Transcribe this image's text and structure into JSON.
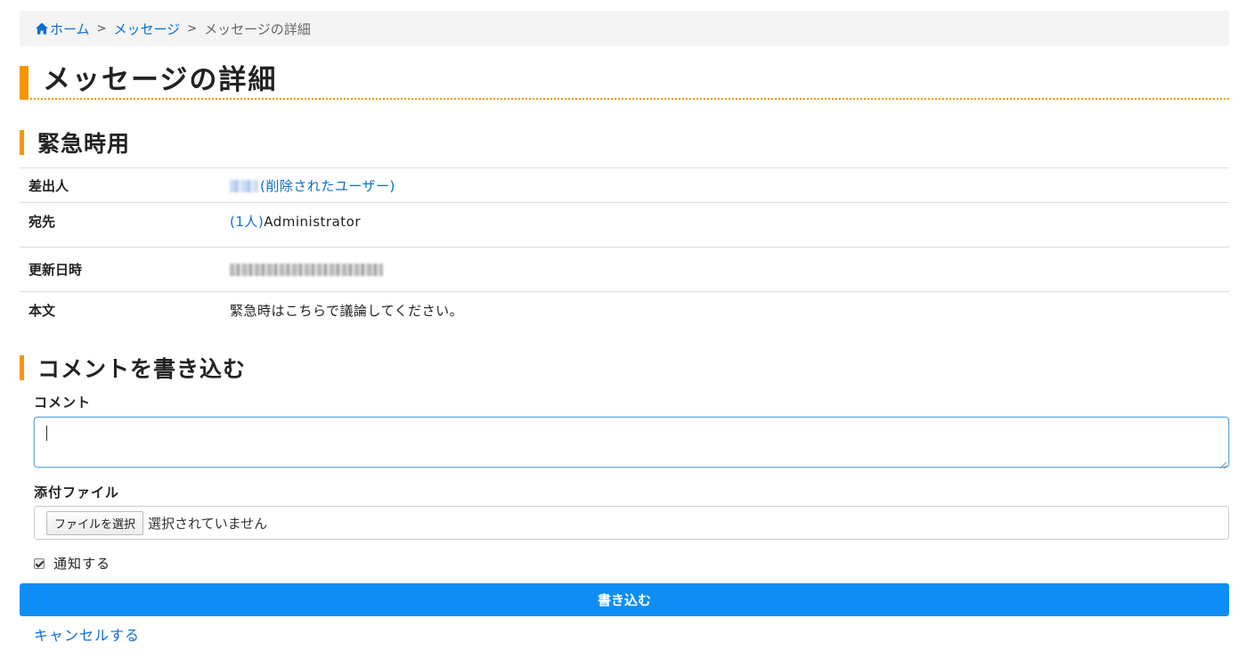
{
  "breadcrumb": {
    "home": "ホーム",
    "separator": ">",
    "messages": "メッセージ",
    "current": "メッセージの詳細"
  },
  "page_title": "メッセージの詳細",
  "message": {
    "subject": "緊急時用",
    "rows": {
      "sender": {
        "label": "差出人",
        "deleted_user": "(削除されたユーザー)"
      },
      "recipient": {
        "label": "宛先",
        "count": "(1人)",
        "name": "Administrator"
      },
      "updated": {
        "label": "更新日時"
      },
      "body": {
        "label": "本文",
        "text": "緊急時はこちらで議論してください。"
      }
    }
  },
  "comment_form": {
    "heading": "コメントを書き込む",
    "comment_label": "コメント",
    "comment_value": "",
    "attachment_label": "添付ファイル",
    "file_button": "ファイルを選択",
    "file_status": "選択されていません",
    "notify_label": "通知する",
    "notify_checked": true,
    "submit_label": "書き込む",
    "cancel_label": "キャンセルする"
  },
  "colors": {
    "accent": "#f39800",
    "link": "#0a6fd1",
    "primary_button": "#0d8df5",
    "breadcrumb_bg": "#f4f4f4"
  }
}
